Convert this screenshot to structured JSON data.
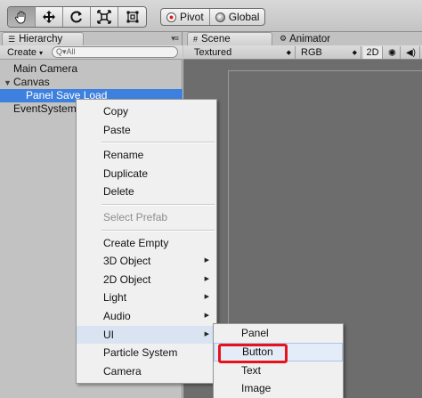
{
  "toolbar": {
    "tools": [
      {
        "icon": "hand-icon",
        "active": true
      },
      {
        "icon": "move-icon",
        "active": false
      },
      {
        "icon": "rotate-icon",
        "active": false
      },
      {
        "icon": "scale-icon",
        "active": false
      },
      {
        "icon": "rect-icon",
        "active": false
      }
    ],
    "pivot_label": "Pivot",
    "global_label": "Global"
  },
  "hierarchy": {
    "tab_label": "Hierarchy",
    "create_label": "Create",
    "search_prefix": "Q▾All",
    "items": [
      {
        "label": "Main Camera"
      },
      {
        "label": "Canvas"
      },
      {
        "label": "Panel Save Load"
      },
      {
        "label": "EventSystem"
      }
    ]
  },
  "scene": {
    "tab_label": "Scene",
    "animator_tab_label": "Animator",
    "shading_mode": "Textured",
    "channel_mode": "RGB",
    "mode_2d_label": "2D"
  },
  "context_menu": {
    "items": [
      "Copy",
      "Paste",
      "Rename",
      "Duplicate",
      "Delete",
      "Select Prefab",
      "Create Empty",
      "3D Object",
      "2D Object",
      "Light",
      "Audio",
      "UI",
      "Particle System",
      "Camera"
    ]
  },
  "ui_submenu": {
    "items": [
      "Panel",
      "Button",
      "Text",
      "Image"
    ]
  },
  "colors": {
    "selection": "#3d80df",
    "highlight_box": "#e8121b",
    "viewport": "#6d6d6d"
  }
}
